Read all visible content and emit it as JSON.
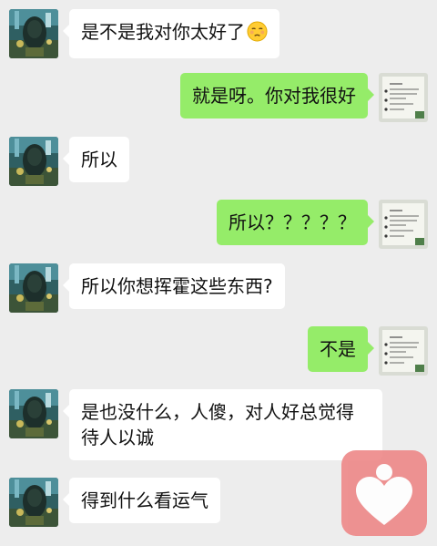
{
  "chat": {
    "messages": [
      {
        "side": "left",
        "text": "是不是我对你太好了",
        "emoji": "unamused-face-emoji"
      },
      {
        "side": "right",
        "text": "就是呀。你对我很好"
      },
      {
        "side": "left",
        "text": "所以"
      },
      {
        "side": "right",
        "text": "所以？？？？？"
      },
      {
        "side": "left",
        "text": "所以你想挥霍这些东西?"
      },
      {
        "side": "right",
        "text": "不是"
      },
      {
        "side": "left",
        "text": "是也没什么，人傻，对人好总觉得待人以诚"
      },
      {
        "side": "left",
        "text": "得到什么看运气"
      }
    ]
  },
  "colors": {
    "background": "#ededed",
    "bubble_left": "#ffffff",
    "bubble_right": "#95ec69",
    "watermark": "#ee8a8a"
  },
  "icons": {
    "avatar_left": "aquarium-photo-avatar",
    "avatar_right": "handwritten-note-avatar",
    "watermark": "heart-person-logo"
  }
}
